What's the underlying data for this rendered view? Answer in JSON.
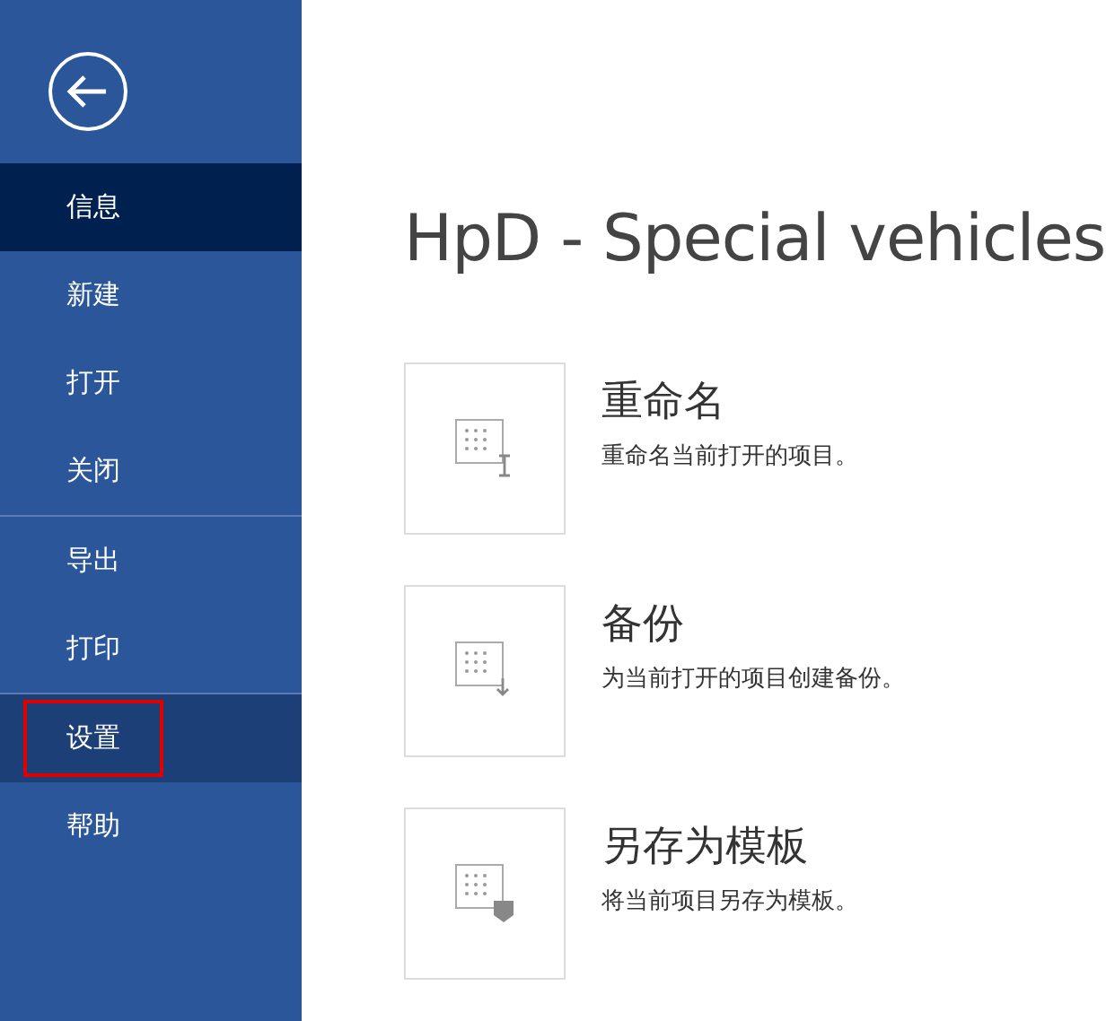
{
  "sidebar": {
    "items": [
      {
        "label": "信息",
        "selected": true,
        "hovered": false,
        "outlined": false,
        "divider_before": false
      },
      {
        "label": "新建",
        "selected": false,
        "hovered": false,
        "outlined": false,
        "divider_before": false
      },
      {
        "label": "打开",
        "selected": false,
        "hovered": false,
        "outlined": false,
        "divider_before": false
      },
      {
        "label": "关闭",
        "selected": false,
        "hovered": false,
        "outlined": false,
        "divider_before": false
      },
      {
        "label": "导出",
        "selected": false,
        "hovered": false,
        "outlined": false,
        "divider_before": true
      },
      {
        "label": "打印",
        "selected": false,
        "hovered": false,
        "outlined": false,
        "divider_before": false
      },
      {
        "label": "设置",
        "selected": false,
        "hovered": true,
        "outlined": true,
        "divider_before": true
      },
      {
        "label": "帮助",
        "selected": false,
        "hovered": false,
        "outlined": false,
        "divider_before": false
      }
    ]
  },
  "title": "HpD - Special vehicles",
  "actions": [
    {
      "kind": "rename",
      "title": "重命名",
      "description": "重命名当前打开的项目。"
    },
    {
      "kind": "backup",
      "title": "备份",
      "description": "为当前打开的项目创建备份。"
    },
    {
      "kind": "template",
      "title": "另存为模板",
      "description": "将当前项目另存为模板。"
    }
  ]
}
